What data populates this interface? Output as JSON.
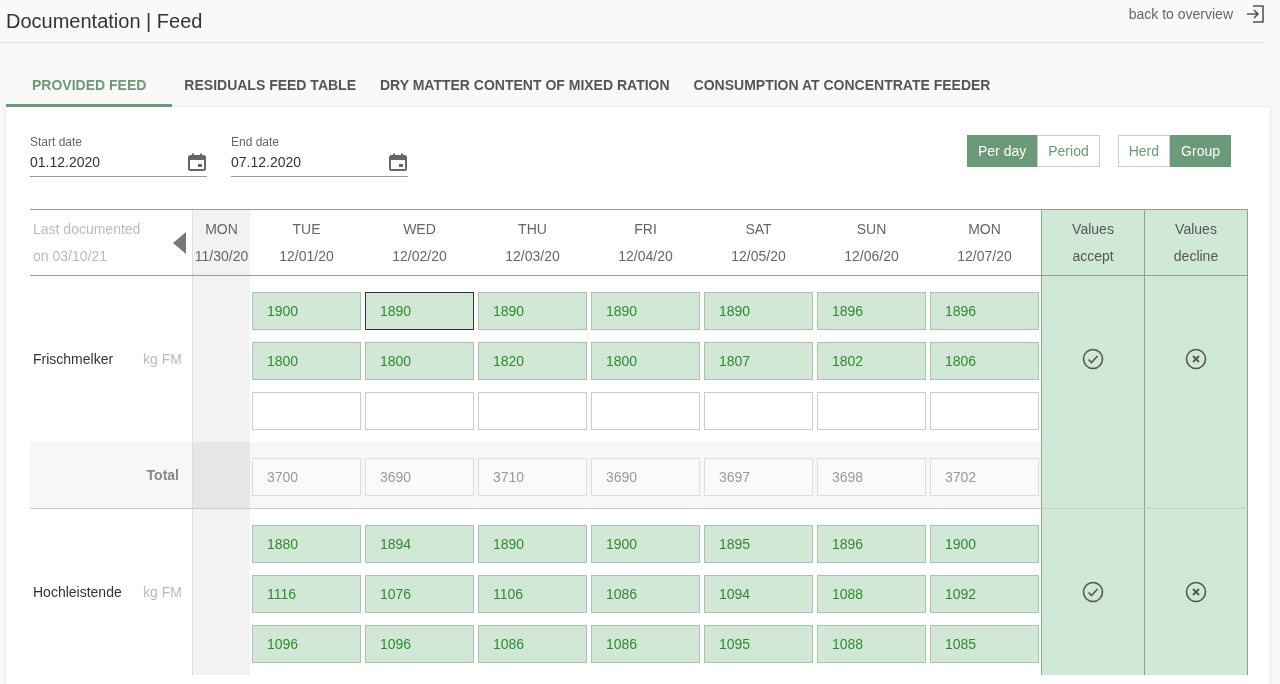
{
  "page": {
    "title": "Documentation | Feed",
    "back_link": "back to overview"
  },
  "tabs": [
    {
      "label": "PROVIDED FEED",
      "selected": true
    },
    {
      "label": "RESIDUALS FEED TABLE",
      "selected": false
    },
    {
      "label": "DRY MATTER CONTENT OF MIXED RATION",
      "selected": false
    },
    {
      "label": "CONSUMPTION AT CONCENTRATE FEEDER",
      "selected": false
    }
  ],
  "date_fields": [
    {
      "label": "Start date",
      "value": "01.12.2020"
    },
    {
      "label": "End date",
      "value": "07.12.2020"
    }
  ],
  "toggle_groups": [
    [
      {
        "label": "Per day",
        "selected": true
      },
      {
        "label": "Period",
        "selected": false
      }
    ],
    [
      {
        "label": "Herd",
        "selected": false
      },
      {
        "label": "Group",
        "selected": true
      }
    ]
  ],
  "table": {
    "last_documented": "Last documented on 03/10/21",
    "days": [
      {
        "day": "MON",
        "date": "11/30/20",
        "kind": "previous"
      },
      {
        "day": "TUE",
        "date": "12/01/20",
        "kind": "current"
      },
      {
        "day": "WED",
        "date": "12/02/20",
        "kind": "current"
      },
      {
        "day": "THU",
        "date": "12/03/20",
        "kind": "current"
      },
      {
        "day": "FRI",
        "date": "12/04/20",
        "kind": "current"
      },
      {
        "day": "SAT",
        "date": "12/05/20",
        "kind": "current"
      },
      {
        "day": "SUN",
        "date": "12/06/20",
        "kind": "current"
      },
      {
        "day": "MON",
        "date": "12/07/20",
        "kind": "current"
      }
    ],
    "accept_header": "Values accept",
    "decline_header": "Values decline",
    "groups": [
      {
        "name": "Frischmelker",
        "unit": "kg FM",
        "rows": [
          [
            {
              "kind": "filled",
              "value": "1900",
              "focused": false
            },
            {
              "kind": "filled",
              "value": "1890",
              "focused": true
            },
            {
              "kind": "filled",
              "value": "1890",
              "focused": false
            },
            {
              "kind": "filled",
              "value": "1890",
              "focused": false
            },
            {
              "kind": "filled",
              "value": "1890",
              "focused": false
            },
            {
              "kind": "filled",
              "value": "1896",
              "focused": false
            },
            {
              "kind": "filled",
              "value": "1896",
              "focused": false
            }
          ],
          [
            {
              "kind": "filled",
              "value": "1800",
              "focused": false
            },
            {
              "kind": "filled",
              "value": "1800",
              "focused": false
            },
            {
              "kind": "filled",
              "value": "1820",
              "focused": false
            },
            {
              "kind": "filled",
              "value": "1800",
              "focused": false
            },
            {
              "kind": "filled",
              "value": "1807",
              "focused": false
            },
            {
              "kind": "filled",
              "value": "1802",
              "focused": false
            },
            {
              "kind": "filled",
              "value": "1806",
              "focused": false
            }
          ],
          [
            {
              "kind": "empty",
              "focused": false
            },
            {
              "kind": "empty",
              "focused": false
            },
            {
              "kind": "empty",
              "focused": false
            },
            {
              "kind": "empty",
              "focused": false
            },
            {
              "kind": "empty",
              "focused": false
            },
            {
              "kind": "empty",
              "focused": false
            },
            {
              "kind": "empty",
              "focused": false
            }
          ]
        ],
        "total_label": "Total",
        "totals": [
          "3700",
          "3690",
          "3710",
          "3690",
          "3697",
          "3698",
          "3702"
        ]
      },
      {
        "name": "Hochleistende",
        "unit": "kg FM",
        "rows": [
          [
            {
              "kind": "filled",
              "value": "1880",
              "focused": false
            },
            {
              "kind": "filled",
              "value": "1894",
              "focused": false
            },
            {
              "kind": "filled",
              "value": "1890",
              "focused": false
            },
            {
              "kind": "filled",
              "value": "1900",
              "focused": false
            },
            {
              "kind": "filled",
              "value": "1895",
              "focused": false
            },
            {
              "kind": "filled",
              "value": "1896",
              "focused": false
            },
            {
              "kind": "filled",
              "value": "1900",
              "focused": false
            }
          ],
          [
            {
              "kind": "filled",
              "value": "1116",
              "focused": false
            },
            {
              "kind": "filled",
              "value": "1076",
              "focused": false
            },
            {
              "kind": "filled",
              "value": "1106",
              "focused": false
            },
            {
              "kind": "filled",
              "value": "1086",
              "focused": false
            },
            {
              "kind": "filled",
              "value": "1094",
              "focused": false
            },
            {
              "kind": "filled",
              "value": "1088",
              "focused": false
            },
            {
              "kind": "filled",
              "value": "1092",
              "focused": false
            }
          ],
          [
            {
              "kind": "filled",
              "value": "1096",
              "focused": false
            },
            {
              "kind": "filled",
              "value": "1096",
              "focused": false
            },
            {
              "kind": "filled",
              "value": "1086",
              "focused": false
            },
            {
              "kind": "filled",
              "value": "1086",
              "focused": false
            },
            {
              "kind": "filled",
              "value": "1095",
              "focused": false
            },
            {
              "kind": "filled",
              "value": "1088",
              "focused": false
            },
            {
              "kind": "filled",
              "value": "1085",
              "focused": false
            }
          ]
        ]
      }
    ]
  }
}
